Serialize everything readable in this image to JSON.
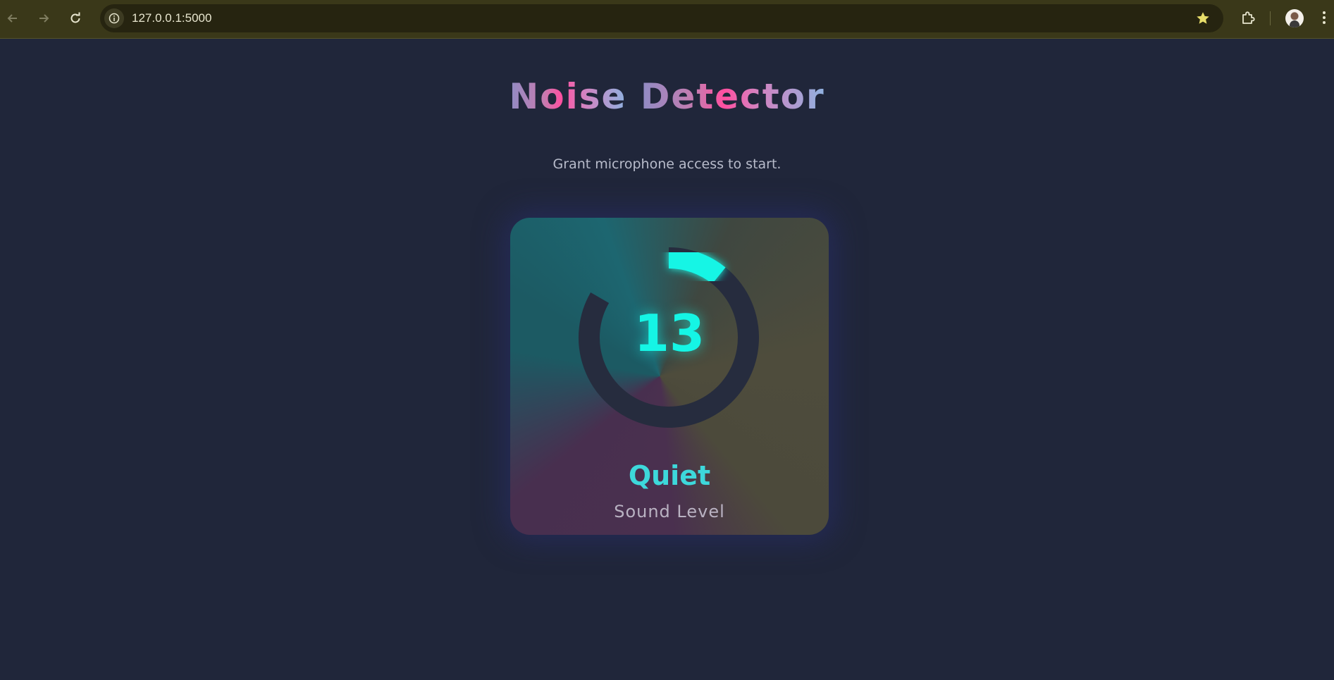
{
  "browser": {
    "url": "127.0.0.1:5000",
    "icons": [
      "back-arrow-icon",
      "forward-arrow-icon",
      "reload-icon",
      "site-info-icon",
      "bookmark-star-icon",
      "extensions-puzzle-icon",
      "profile-avatar",
      "kebab-menu-icon"
    ]
  },
  "page": {
    "title_part1": "Noise",
    "title_part2": "Detector",
    "subtitle": "Grant microphone access to start.",
    "meter": {
      "value": "13",
      "level_fraction": 0.13,
      "status": "Quiet",
      "caption": "Sound Level"
    }
  },
  "colors": {
    "accent": "#15f5e5",
    "title_pink": "#ff4fa0",
    "ring_track": "#262c3e",
    "background": "#20263a"
  }
}
